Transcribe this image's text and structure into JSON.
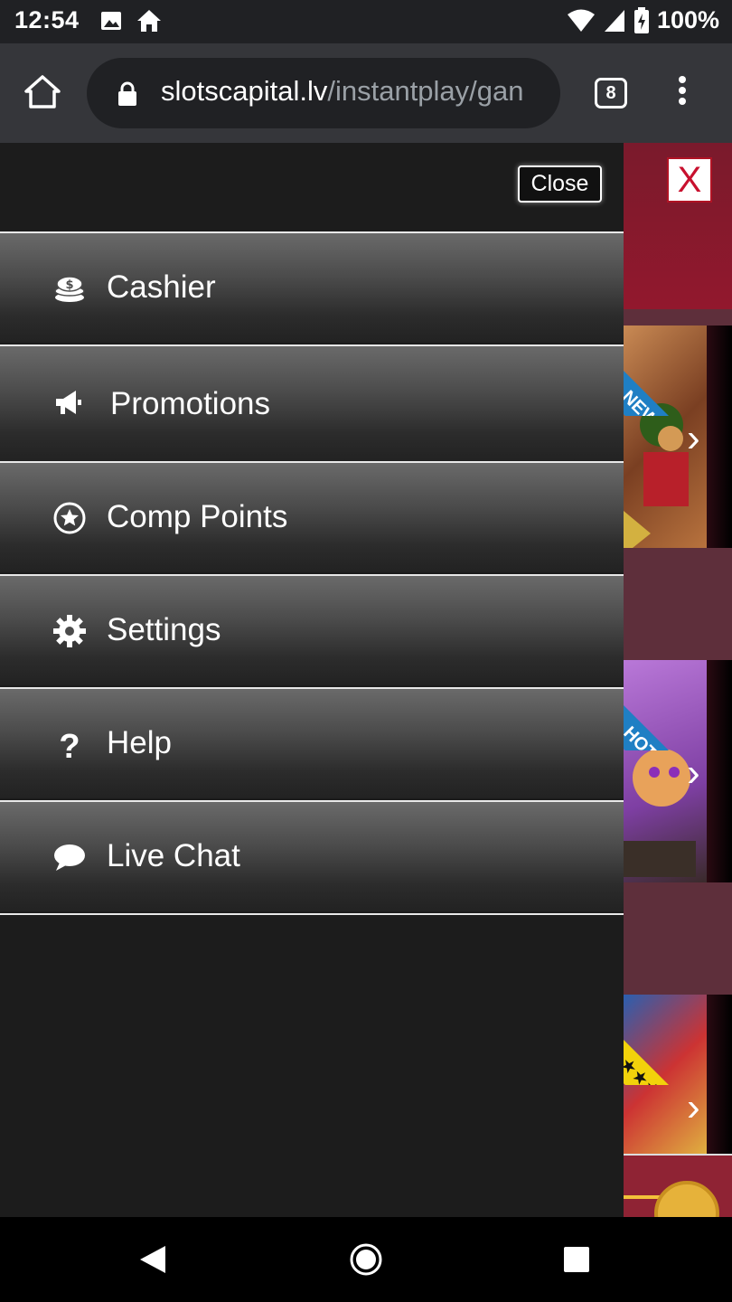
{
  "status_bar": {
    "time": "12:54",
    "battery": "100%",
    "icons": [
      "image-icon",
      "home-notification-icon",
      "wifi-icon",
      "signal-icon",
      "battery-icon"
    ]
  },
  "browser": {
    "url_domain": "slotscapital.lv",
    "url_path": "/instantplay/gan",
    "tab_count": "8"
  },
  "drawer": {
    "close_label": "Close",
    "items": [
      {
        "label": "Cashier",
        "icon": "coins-icon"
      },
      {
        "label": "Promotions",
        "icon": "megaphone-icon"
      },
      {
        "label": "Comp Points",
        "icon": "star-circle-icon"
      },
      {
        "label": "Settings",
        "icon": "gear-icon"
      },
      {
        "label": "Help",
        "icon": "question-icon"
      },
      {
        "label": "Live Chat",
        "icon": "chat-bubble-icon"
      }
    ]
  },
  "background_page": {
    "close_x": "X",
    "ribbons": [
      "NEW",
      "HOT",
      "★★★"
    ]
  },
  "colors": {
    "drawer_bg": "#1c1c1c",
    "brand_red": "#92182d",
    "ribbon_blue": "#1f7fc4",
    "ribbon_yellow": "#f2d20b"
  }
}
